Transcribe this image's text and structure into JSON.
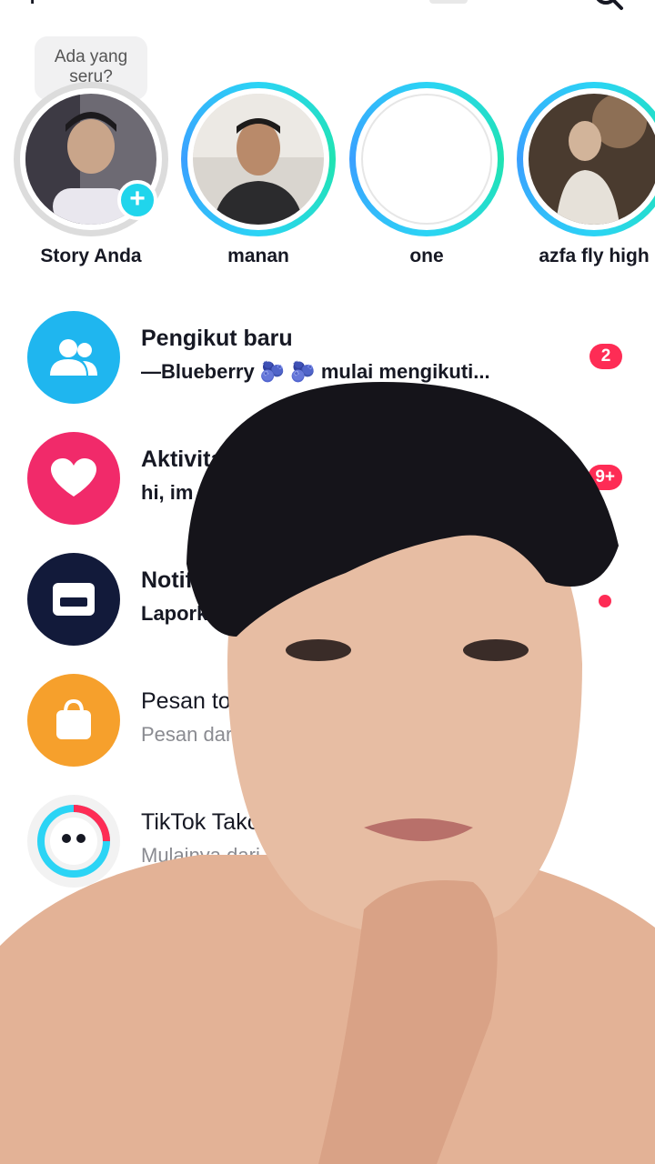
{
  "topbar": {
    "left_glyph": "+"
  },
  "stories": [
    {
      "name": "Story Anda",
      "bubble": "Ada yang seru?",
      "has_add": true,
      "ring": "gray"
    },
    {
      "name": "manan",
      "ring": "grad"
    },
    {
      "name": "one",
      "ring": "grad"
    },
    {
      "name": "azfa fly high",
      "ring": "grad"
    }
  ],
  "add_story_symbol": "+",
  "list": [
    {
      "title": "Pengikut baru",
      "sub": "—Blueberry 🫐 🫐 mulai mengikuti...",
      "badge": "2",
      "color": "#1fb6ef",
      "icon": "people-icon"
    },
    {
      "title": "Aktivitas",
      "sub": "hi, im",
      "badge": "9+",
      "color": "#f12a6a",
      "icon": "heart-icon"
    },
    {
      "title": "Notifikasi",
      "sub": "Laporkan",
      "dot": true,
      "color": "#121a3a",
      "icon": "inbox-icon"
    },
    {
      "title": "Pesan toko",
      "sub": "Pesan dari",
      "color": "#f6a02c",
      "icon": "shopping-bag-icon"
    },
    {
      "title": "TikTok Tako",
      "sub": "Mulainya dari m",
      "color": "#ffffff",
      "icon": "tako-icon"
    },
    {
      "title": "",
      "sub": "",
      "color": "#3f4a82",
      "icon": "chat-icon"
    }
  ],
  "colors": {
    "accent": "#20d5ec",
    "badge": "#fe2c55"
  }
}
